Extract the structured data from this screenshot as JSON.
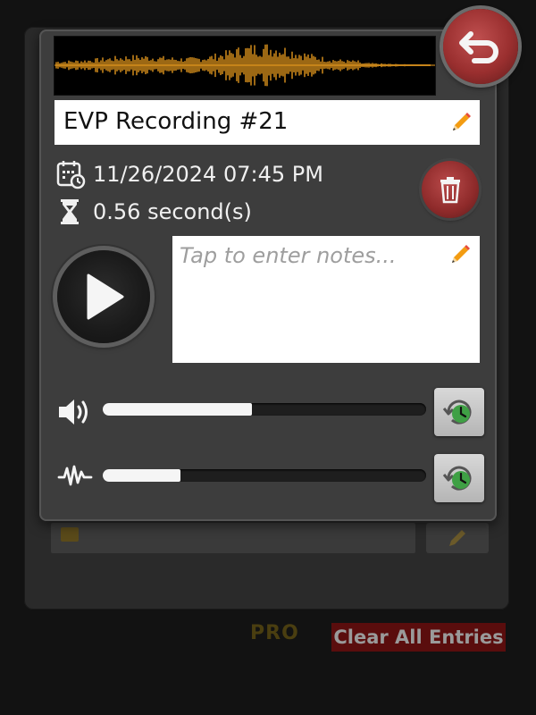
{
  "recording": {
    "title": "EVP Recording #21",
    "datetime": "11/26/2024 07:45 PM",
    "duration": "0.56 second(s)",
    "notes_placeholder": "Tap to enter notes...",
    "notes_value": ""
  },
  "sliders": {
    "volume": {
      "level": 0.46
    },
    "filter": {
      "level": 0.24
    }
  },
  "background": {
    "pro_label": "PRO",
    "clear_all_label": "Clear All Entries"
  },
  "icons": {
    "back": "undo-arrow-icon",
    "edit_title": "pencil-icon",
    "edit_notes": "pencil-icon",
    "calendar": "calendar-clock-icon",
    "duration": "hourglass-icon",
    "delete": "trash-icon",
    "play": "play-icon",
    "volume": "speaker-icon",
    "filter": "waveform-icon",
    "reset": "clock-reset-icon"
  },
  "colors": {
    "waveform": "#f0a020",
    "dialog_bg": "#3d3d3d",
    "accent_red": "#9a2f2f",
    "clear_btn_bg": "#5a0d0d"
  }
}
